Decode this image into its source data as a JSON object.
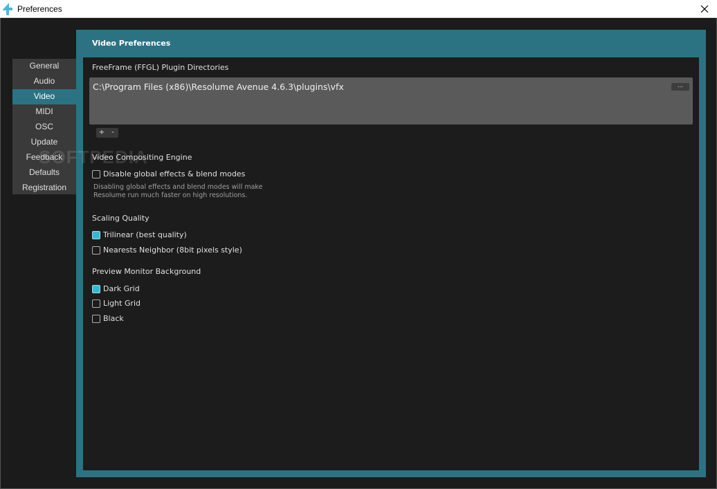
{
  "window": {
    "title": "Preferences",
    "close_symbol": "✕"
  },
  "sidebar": {
    "items": [
      {
        "label": "General",
        "active": false
      },
      {
        "label": "Audio",
        "active": false
      },
      {
        "label": "Video",
        "active": true
      },
      {
        "label": "MIDI",
        "active": false
      },
      {
        "label": "OSC",
        "active": false
      },
      {
        "label": "Update",
        "active": false
      },
      {
        "label": "Feedback",
        "active": false
      },
      {
        "label": "Defaults",
        "active": false
      },
      {
        "label": "Registration",
        "active": false
      }
    ]
  },
  "watermark": "SOFTPEDIA",
  "panel": {
    "title": "Video Preferences",
    "ffgl": {
      "heading": "FreeFrame (FFGL) Plugin Directories",
      "directories": [
        "C:\\Program Files (x86)\\Resolume Avenue 4.6.3\\plugins\\vfx"
      ],
      "browse_label": "...",
      "add_label": "+",
      "remove_label": "-"
    },
    "compositing": {
      "heading": "Video Compositing Engine",
      "option": {
        "label": "Disable global effects & blend modes",
        "checked": false
      },
      "note_line1": "Disabling global effects and blend modes will make",
      "note_line2": "Resolume run much faster on high resolutions."
    },
    "scaling": {
      "heading": "Scaling Quality",
      "options": [
        {
          "label": "Trilinear (best quality)",
          "checked": true
        },
        {
          "label": "Nearests Neighbor (8bit pixels style)",
          "checked": false
        }
      ]
    },
    "preview": {
      "heading": "Preview Monitor Background",
      "options": [
        {
          "label": "Dark Grid",
          "checked": true
        },
        {
          "label": "Light Grid",
          "checked": false
        },
        {
          "label": "Black",
          "checked": false
        }
      ]
    }
  },
  "colors": {
    "accent": "#2b7383",
    "checkbox_checked": "#37b8d2",
    "panel_bg": "#1c1c1c"
  }
}
